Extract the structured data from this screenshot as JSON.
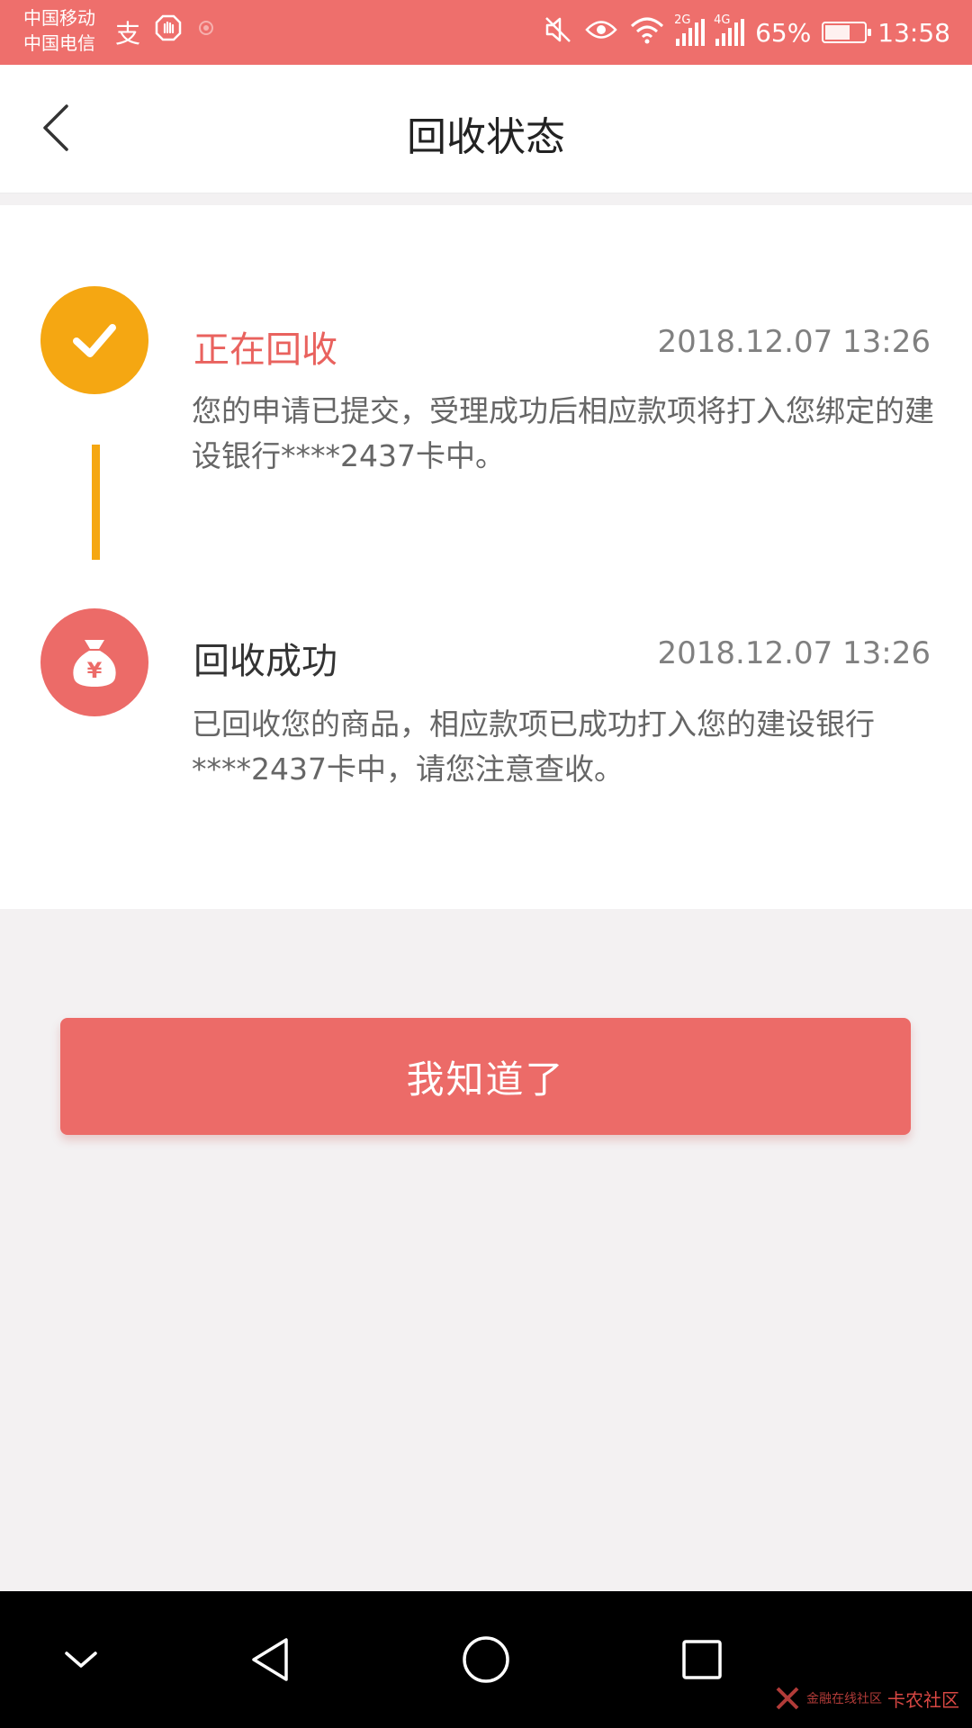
{
  "status_bar": {
    "carrier_1": "中国移动",
    "carrier_2": "中国电信",
    "signal_1_label": "2G",
    "signal_2_label": "4G",
    "battery_percent": "65%",
    "battery_level": 0.65,
    "time": "13:58",
    "icons": [
      "alipay-icon",
      "hand-icon",
      "notification-dot-icon",
      "mute-icon",
      "eye-icon",
      "wifi-icon",
      "signal-icon",
      "signal-icon",
      "battery-icon"
    ]
  },
  "header": {
    "title": "回收状态",
    "back_icon": "chevron-left-icon"
  },
  "timeline": [
    {
      "title": "正在回收",
      "time": "2018.12.07 13:26",
      "description": "您的申请已提交，受理成功后相应款项将打入您绑定的建设银行****2437卡中。",
      "icon": "check-icon",
      "icon_color": "#f5a712",
      "title_color": "#e9625e"
    },
    {
      "title": "回收成功",
      "time": "2018.12.07 13:26",
      "description": "已回收您的商品，相应款项已成功打入您的建设银行****2437卡中，请您注意查收。",
      "icon": "money-bag-icon",
      "icon_glyph": "¥",
      "icon_color": "#ec6b68",
      "title_color": "#333333"
    }
  ],
  "confirm_button": {
    "label": "我知道了",
    "color": "#ec6b68"
  },
  "nav_bar": {
    "icons": [
      "chevron-down-icon",
      "back-triangle-icon",
      "home-circle-icon",
      "recents-square-icon"
    ]
  },
  "watermark": {
    "text": "卡农社区",
    "subtext": "金融在线社区",
    "logo_icon": "kanong-logo-icon"
  },
  "colors": {
    "accent": "#ec6b68",
    "status_bar": "#ee6f6c",
    "pending": "#f5a712",
    "background": "#f3f1f2"
  }
}
